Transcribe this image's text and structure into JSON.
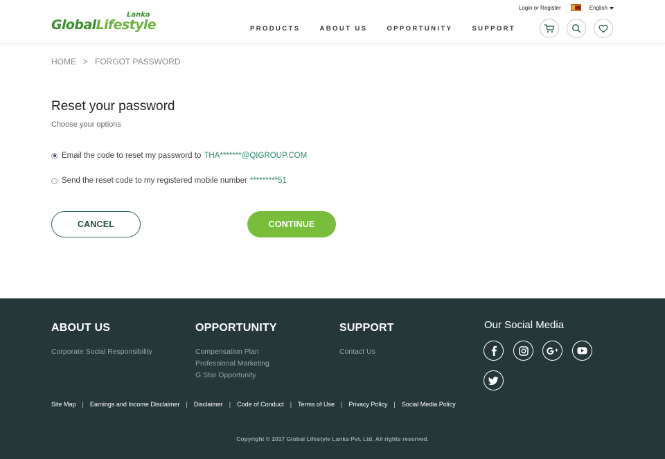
{
  "header": {
    "logo_main_1": "Global",
    "logo_main_2": "Lifestyle",
    "logo_sub": "Lanka",
    "login": "Login or Register",
    "language": "English",
    "nav": [
      "PRODUCTS",
      "ABOUT US",
      "OPPORTUNITY",
      "SUPPORT"
    ],
    "icons": [
      "cart-icon",
      "search-icon",
      "heart-icon"
    ]
  },
  "breadcrumb": {
    "home": "HOME",
    "separator": ">",
    "current": "FORGOT PASSWORD"
  },
  "main": {
    "title": "Reset your password",
    "subtitle": "Choose your options",
    "options": [
      {
        "label": "Email the code to reset my password to",
        "value": "THA*******@QIGROUP.COM",
        "checked": true
      },
      {
        "label": "Send the reset code to my registered mobile number",
        "value": "*********51",
        "checked": false
      }
    ],
    "cancel_label": "CANCEL",
    "continue_label": "CONTINUE"
  },
  "footer": {
    "about_title": "ABOUT US",
    "about_links": [
      "Corporate Social Responsibility"
    ],
    "opportunity_title": "OPPORTUNITY",
    "opportunity_links": [
      "Compensation Plan",
      "Professional Marketing",
      "G Star Opportunity"
    ],
    "support_title": "SUPPORT",
    "support_links": [
      "Contact Us"
    ],
    "social_title": "Our Social Media",
    "social_icons": [
      "facebook-icon",
      "instagram-icon",
      "google-plus-icon",
      "youtube-icon",
      "twitter-icon"
    ],
    "bottom_links": [
      "Site Map",
      "Earnings and Income Disclaimer",
      "Disclaimer",
      "Code of Conduct",
      "Terms of Use",
      "Privacy Policy",
      "Social Media Policy"
    ],
    "bottom_separator": "|",
    "copyright": "Copyright © 2017 Global Lifestyle Lanka Pvt. Ltd. All rights reserved."
  },
  "colors": {
    "accent_green": "#78be3c",
    "dark_green": "#1f4f3e",
    "footer_bg": "#253739",
    "email_highlight": "#2c8a6e"
  }
}
